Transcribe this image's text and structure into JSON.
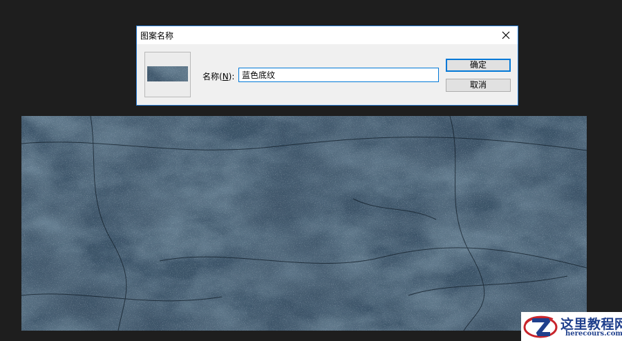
{
  "dialog": {
    "title": "图案名称",
    "name_label_prefix": "名称(",
    "name_label_mnemonic": "N",
    "name_label_suffix": "):",
    "name_value": "蓝色底纹",
    "ok_label": "确定",
    "cancel_label": "取消"
  },
  "watermark": {
    "text_cn": "这里教程网",
    "text_en": "herecours.com"
  },
  "colors": {
    "accent": "#0078d7",
    "texture_base": "#26394a",
    "background": "#1e1e1e"
  },
  "icons": {
    "close": "close-icon",
    "logo": "z-logo-icon"
  }
}
